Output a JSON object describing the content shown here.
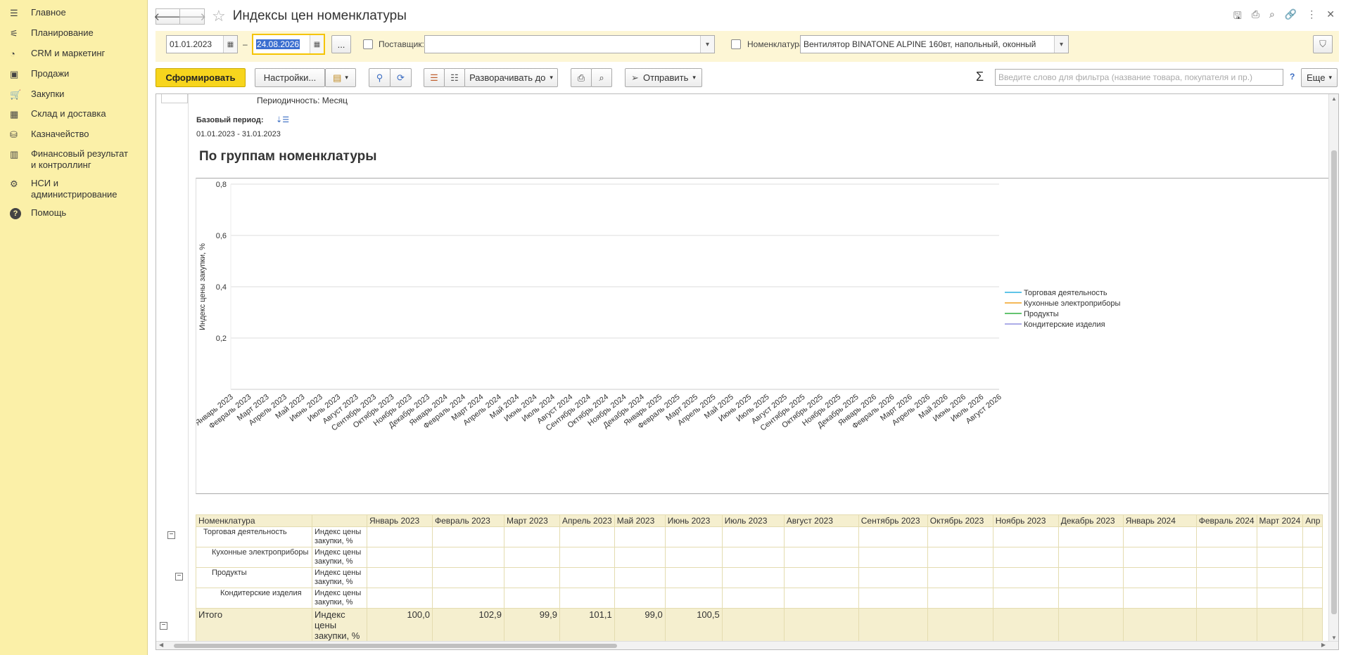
{
  "sidebar": {
    "items": [
      {
        "label": "Главное",
        "icon": "menu-icon"
      },
      {
        "label": "Планирование",
        "icon": "planning-icon"
      },
      {
        "label": "CRM и маркетинг",
        "icon": "pie-icon"
      },
      {
        "label": "Продажи",
        "icon": "bag-icon"
      },
      {
        "label": "Закупки",
        "icon": "cart-icon"
      },
      {
        "label": "Склад и доставка",
        "icon": "grid-icon"
      },
      {
        "label": "Казначейство",
        "icon": "treasury-icon"
      },
      {
        "label": "Финансовый результат и контроллинг",
        "icon": "chart-icon"
      },
      {
        "label": "НСИ и администрирование",
        "icon": "gear-icon"
      },
      {
        "label": "Помощь",
        "icon": "help-icon"
      }
    ]
  },
  "header": {
    "title": "Индексы цен номенклатуры"
  },
  "params": {
    "date_from": "01.01.2023",
    "dash": "–",
    "date_to": "24.08.2026",
    "ellipsis": "...",
    "supplier_label": "Поставщик:",
    "supplier_value": "",
    "nomenclature_label": "Номенклатура:",
    "nomenclature_value": "Вентилятор BINATONE ALPINE 160вт, напольный, оконный"
  },
  "toolbar": {
    "generate": "Сформировать",
    "settings": "Настройки...",
    "expand_to": "Разворачивать до",
    "send": "Отправить",
    "sum_symbol": "Σ",
    "search_placeholder": "Введите слово для фильтра (название товара, покупателя и пр.)",
    "help": "?",
    "more": "Еще"
  },
  "report": {
    "periodicity": "Периодичность: Месяц",
    "base_period_label": "Базовый период:",
    "base_period_value": "01.01.2023 - 31.01.2023",
    "heading": "По группам номенклатуры"
  },
  "chart_data": {
    "type": "line",
    "title": "",
    "xlabel": "",
    "ylabel": "Индекс цены закупки, %",
    "ylim": [
      0,
      0.8
    ],
    "yticks": [
      "0,2",
      "0,4",
      "0,6",
      "0,8"
    ],
    "categories": [
      "Январь 2023",
      "Февраль 2023",
      "Март 2023",
      "Апрель 2023",
      "Май 2023",
      "Июнь 2023",
      "Июль 2023",
      "Август 2023",
      "Сентябрь 2023",
      "Октябрь 2023",
      "Ноябрь 2023",
      "Декабрь 2023",
      "Январь 2024",
      "Февраль 2024",
      "Март 2024",
      "Апрель 2024",
      "Май 2024",
      "Июнь 2024",
      "Июль 2024",
      "Август 2024",
      "Сентябрь 2024",
      "Октябрь 2024",
      "Ноябрь 2024",
      "Декабрь 2024",
      "Январь 2025",
      "Февраль 2025",
      "Март 2025",
      "Апрель 2025",
      "Май 2025",
      "Июнь 2025",
      "Июль 2025",
      "Август 2025",
      "Сентябрь 2025",
      "Октябрь 2025",
      "Ноябрь 2025",
      "Декабрь 2025",
      "Январь 2026",
      "Февраль 2026",
      "Март 2026",
      "Апрель 2026",
      "Май 2026",
      "Июнь 2026",
      "Июль 2026",
      "Август 2026"
    ],
    "grid": true,
    "legend_position": "right",
    "series": [
      {
        "name": "Торговая деятельность",
        "color": "#2ab0e0",
        "values": []
      },
      {
        "name": "Кухонные электроприборы",
        "color": "#f0a020",
        "values": []
      },
      {
        "name": "Продукты",
        "color": "#30b040",
        "values": []
      },
      {
        "name": "Кондитерские изделия",
        "color": "#9090e0",
        "values": []
      }
    ]
  },
  "table": {
    "col_nomenclature": "Номенклатура",
    "months": [
      "Январь 2023",
      "Февраль 2023",
      "Март 2023",
      "Апрель 2023",
      "Май 2023",
      "Июнь 2023",
      "Июль 2023",
      "Август 2023",
      "Сентябрь 2023",
      "Октябрь 2023",
      "Ноябрь 2023",
      "Декабрь 2023",
      "Январь 2024",
      "Февраль 2024",
      "Март 2024",
      "Апр"
    ],
    "rows": [
      {
        "name": "Торговая деятельность",
        "indicator": "Индекс цены закупки, %"
      },
      {
        "name": "Кухонные электроприборы",
        "indicator": "Индекс цены закупки, %"
      },
      {
        "name": "Продукты",
        "indicator": "Индекс цены закупки, %"
      },
      {
        "name": "Кондитерские изделия",
        "indicator": "Индекс цены закупки, %"
      }
    ],
    "total": {
      "name": "Итого",
      "indicator": "Индекс цены закупки, %",
      "values": [
        "100,0",
        "102,9",
        "99,9",
        "101,1",
        "99,0",
        "100,5"
      ]
    }
  }
}
